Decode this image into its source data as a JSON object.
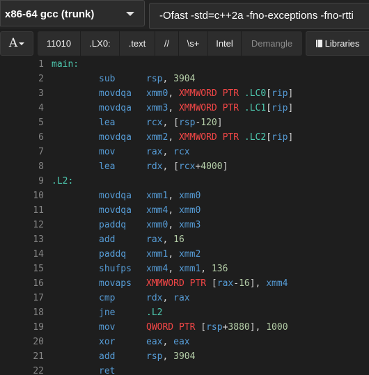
{
  "compiler": {
    "label": "x86-64 gcc (trunk)",
    "dropdown_icon": "caret-down-icon"
  },
  "options": {
    "value": "-Ofast -std=c++2a -fno-exceptions -fno-rtti"
  },
  "toolbar": {
    "font_label": "A",
    "filters": [
      {
        "label": "11010",
        "dim": false
      },
      {
        "label": ".LX0:",
        "dim": false
      },
      {
        "label": ".text",
        "dim": false
      },
      {
        "label": "//",
        "dim": false
      },
      {
        "label": "\\s+",
        "dim": false
      },
      {
        "label": "Intel",
        "dim": false
      },
      {
        "label": "Demangle",
        "dim": true
      }
    ],
    "libraries_label": "Libraries",
    "libraries_icon": "book-icon"
  },
  "colors": {
    "label": "#4ec9b0",
    "mnemonic": "#569cd6",
    "register": "#569cd6",
    "pointer": "#f44747",
    "number": "#b5cea8",
    "line_number": "#858585",
    "background": "#1e1e1e"
  },
  "code": [
    {
      "n": "1",
      "label": "main:"
    },
    {
      "n": "2",
      "op": "sub",
      "args": [
        [
          "reg",
          "rsp"
        ],
        [
          "t",
          ", "
        ],
        [
          "num",
          "3904"
        ]
      ]
    },
    {
      "n": "3",
      "op": "movdqa",
      "args": [
        [
          "reg",
          "xmm0"
        ],
        [
          "t",
          ", "
        ],
        [
          "ptr",
          "XMMWORD PTR "
        ],
        [
          "lbl",
          ".LC0"
        ],
        [
          "t",
          "["
        ],
        [
          "reg",
          "rip"
        ],
        [
          "t",
          "]"
        ]
      ]
    },
    {
      "n": "4",
      "op": "movdqa",
      "args": [
        [
          "reg",
          "xmm3"
        ],
        [
          "t",
          ", "
        ],
        [
          "ptr",
          "XMMWORD PTR "
        ],
        [
          "lbl",
          ".LC1"
        ],
        [
          "t",
          "["
        ],
        [
          "reg",
          "rip"
        ],
        [
          "t",
          "]"
        ]
      ]
    },
    {
      "n": "5",
      "op": "lea",
      "args": [
        [
          "reg",
          "rcx"
        ],
        [
          "t",
          ", ["
        ],
        [
          "reg",
          "rsp"
        ],
        [
          "t",
          "-"
        ],
        [
          "num",
          "120"
        ],
        [
          "t",
          "]"
        ]
      ]
    },
    {
      "n": "6",
      "op": "movdqa",
      "args": [
        [
          "reg",
          "xmm2"
        ],
        [
          "t",
          ", "
        ],
        [
          "ptr",
          "XMMWORD PTR "
        ],
        [
          "lbl",
          ".LC2"
        ],
        [
          "t",
          "["
        ],
        [
          "reg",
          "rip"
        ],
        [
          "t",
          "]"
        ]
      ]
    },
    {
      "n": "7",
      "op": "mov",
      "args": [
        [
          "reg",
          "rax"
        ],
        [
          "t",
          ", "
        ],
        [
          "reg",
          "rcx"
        ]
      ]
    },
    {
      "n": "8",
      "op": "lea",
      "args": [
        [
          "reg",
          "rdx"
        ],
        [
          "t",
          ", ["
        ],
        [
          "reg",
          "rcx"
        ],
        [
          "t",
          "+"
        ],
        [
          "num",
          "4000"
        ],
        [
          "t",
          "]"
        ]
      ]
    },
    {
      "n": "9",
      "label": ".L2:"
    },
    {
      "n": "10",
      "op": "movdqa",
      "args": [
        [
          "reg",
          "xmm1"
        ],
        [
          "t",
          ", "
        ],
        [
          "reg",
          "xmm0"
        ]
      ]
    },
    {
      "n": "11",
      "op": "movdqa",
      "args": [
        [
          "reg",
          "xmm4"
        ],
        [
          "t",
          ", "
        ],
        [
          "reg",
          "xmm0"
        ]
      ]
    },
    {
      "n": "12",
      "op": "paddq",
      "args": [
        [
          "reg",
          "xmm0"
        ],
        [
          "t",
          ", "
        ],
        [
          "reg",
          "xmm3"
        ]
      ]
    },
    {
      "n": "13",
      "op": "add",
      "args": [
        [
          "reg",
          "rax"
        ],
        [
          "t",
          ", "
        ],
        [
          "num",
          "16"
        ]
      ]
    },
    {
      "n": "14",
      "op": "paddq",
      "args": [
        [
          "reg",
          "xmm1"
        ],
        [
          "t",
          ", "
        ],
        [
          "reg",
          "xmm2"
        ]
      ]
    },
    {
      "n": "15",
      "op": "shufps",
      "args": [
        [
          "reg",
          "xmm4"
        ],
        [
          "t",
          ", "
        ],
        [
          "reg",
          "xmm1"
        ],
        [
          "t",
          ", "
        ],
        [
          "num",
          "136"
        ]
      ]
    },
    {
      "n": "16",
      "op": "movaps",
      "args": [
        [
          "ptr",
          "XMMWORD PTR "
        ],
        [
          "t",
          "["
        ],
        [
          "reg",
          "rax"
        ],
        [
          "t",
          "-"
        ],
        [
          "num",
          "16"
        ],
        [
          "t",
          "], "
        ],
        [
          "reg",
          "xmm4"
        ]
      ]
    },
    {
      "n": "17",
      "op": "cmp",
      "args": [
        [
          "reg",
          "rdx"
        ],
        [
          "t",
          ", "
        ],
        [
          "reg",
          "rax"
        ]
      ]
    },
    {
      "n": "18",
      "op": "jne",
      "args": [
        [
          "lbl",
          ".L2"
        ]
      ]
    },
    {
      "n": "19",
      "op": "mov",
      "args": [
        [
          "ptr",
          "QWORD PTR "
        ],
        [
          "t",
          "["
        ],
        [
          "reg",
          "rsp"
        ],
        [
          "t",
          "+"
        ],
        [
          "num",
          "3880"
        ],
        [
          "t",
          "], "
        ],
        [
          "num",
          "1000"
        ]
      ]
    },
    {
      "n": "20",
      "op": "xor",
      "args": [
        [
          "reg",
          "eax"
        ],
        [
          "t",
          ", "
        ],
        [
          "reg",
          "eax"
        ]
      ]
    },
    {
      "n": "21",
      "op": "add",
      "args": [
        [
          "reg",
          "rsp"
        ],
        [
          "t",
          ", "
        ],
        [
          "num",
          "3904"
        ]
      ]
    },
    {
      "n": "22",
      "op": "ret"
    }
  ]
}
